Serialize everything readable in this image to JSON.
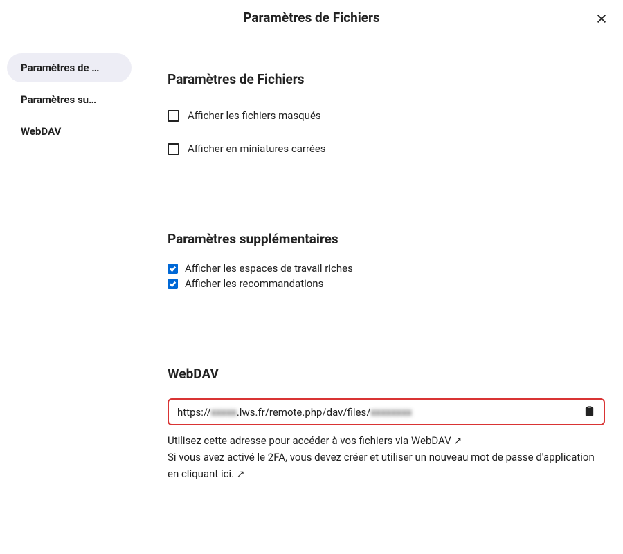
{
  "modal": {
    "title": "Paramètres de Fichiers"
  },
  "sidebar": {
    "items": [
      {
        "label": "Paramètres de …",
        "active": true
      },
      {
        "label": "Paramètres su…",
        "active": false
      },
      {
        "label": "WebDAV",
        "active": false
      }
    ]
  },
  "sections": {
    "files": {
      "title": "Paramètres de Fichiers",
      "options": [
        {
          "label": "Afficher les fichiers masqués",
          "checked": false
        },
        {
          "label": "Afficher en miniatures carrées",
          "checked": false
        }
      ]
    },
    "additional": {
      "title": "Paramètres supplémentaires",
      "options": [
        {
          "label": "Afficher les espaces de travail riches",
          "checked": true
        },
        {
          "label": "Afficher les recommandations",
          "checked": true
        }
      ]
    },
    "webdav": {
      "title": "WebDAV",
      "url_pre": "https://",
      "url_hidden1": "xxxxx",
      "url_mid": ".lws.fr/remote.php/dav/files/",
      "url_hidden2": "xxxxxxxx",
      "help1": "Utilisez cette adresse pour accéder à vos fichiers via WebDAV ",
      "arrow1": "↗",
      "help2a": "Si vous avez activé le 2FA, vous devez créer et utiliser un nouveau mot de passe d'application ",
      "help2b": "en cliquant ici. ",
      "arrow2": "↗"
    }
  }
}
